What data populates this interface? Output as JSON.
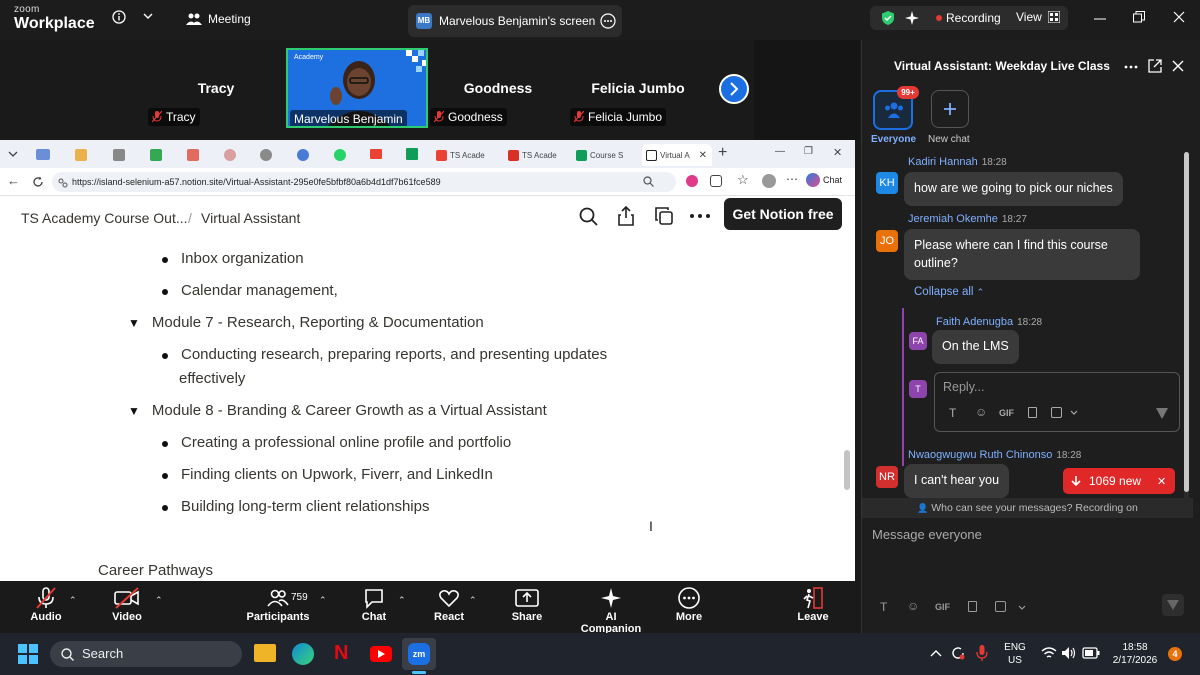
{
  "zoom": {
    "brand_top": "zoom",
    "brand_main": "Workplace",
    "meeting_label": "Meeting",
    "screen_badge": "MB",
    "screen_label": "Marvelous Benjamin's screen",
    "recording_label": "Recording",
    "view_label": "View"
  },
  "participants": [
    {
      "name": "Tracy",
      "tag": "Tracy"
    },
    {
      "name": "Marvelous Benjamin",
      "tag": "Marvelous Benjamin",
      "video_brand": "Academy"
    },
    {
      "name": "Goodness",
      "tag": "Goodness"
    },
    {
      "name": "Felicia Jumbo",
      "tag": "Felicia Jumbo"
    }
  ],
  "browser": {
    "tabs": [
      {
        "label": "TS Acade",
        "color": "#d93025"
      },
      {
        "label": "TS Acade",
        "color": "#d93025"
      },
      {
        "label": "Course S",
        "color": "#0f9d58"
      },
      {
        "label": "Virtual A",
        "color": "#222222",
        "active": true
      }
    ],
    "url": "https://island-selenium-a57.notion.site/Virtual-Assistant-295e0fe5bfbf80a6b4d1df7b61fce589",
    "chat_btn": "Chat"
  },
  "notion": {
    "crumb_parent": "TS Academy Course Out...",
    "crumb_sep": "/",
    "crumb_current": "Virtual Assistant",
    "get_notion": "Get Notion free",
    "lines": {
      "b1": "Inbox organization",
      "b2": "Calendar management,",
      "m7": "Module 7 - Research, Reporting & Documentation",
      "b3a": "Conducting research, preparing reports, and presenting updates",
      "b3b": "effectively",
      "m8": "Module 8 - Branding & Career Growth as a Virtual Assistant",
      "b4": "Creating a professional online profile and portfolio",
      "b5": "Finding clients on Upwork, Fiverr, and LinkedIn",
      "b6": "Building long-term client relationships",
      "section": "Career Pathways"
    }
  },
  "toolbar": {
    "audio": "Audio",
    "video": "Video",
    "participants": "Participants",
    "participants_count": "759",
    "chat": "Chat",
    "react": "React",
    "share": "Share",
    "ai": "AI Companion",
    "more": "More",
    "leave": "Leave"
  },
  "chat": {
    "title": "Virtual Assistant: Weekday Live Class",
    "everyone_label": "Everyone",
    "everyone_badge": "99+",
    "new_chat_label": "New chat",
    "messages": [
      {
        "initials": "KH",
        "sender": "Kadiri Hannah",
        "time": "18:28",
        "text": "how are we going to pick our niches",
        "color": "#1e88e5"
      },
      {
        "initials": "JO",
        "sender": "Jeremiah Okemhe",
        "time": "18:27",
        "text1": "Please where can I find this course",
        "text2": "outline?",
        "color": "#e8710a"
      },
      {
        "initials": "FA",
        "sender": "Faith Adenugba",
        "time": "18:28",
        "text": "On the LMS",
        "color": "#8e44ad"
      },
      {
        "initials": "NR",
        "sender": "Nwaogwugwu Ruth Chinonso",
        "time": "18:28",
        "text": "I can't hear you",
        "color": "#d32f2f"
      }
    ],
    "collapse_all": "Collapse all",
    "reply_avatar": "T",
    "reply_placeholder": "Reply...",
    "gif": "GIF",
    "new_count": "1069 new",
    "privacy": "Who can see your messages? Recording on",
    "compose_placeholder": "Message everyone"
  },
  "taskbar": {
    "search": "Search",
    "lang1": "ENG",
    "lang2": "US",
    "time": "18:58",
    "date": "2/17/2026",
    "notif": "4"
  },
  "colors": {
    "zoom_blue": "#1b6fe3",
    "record_red": "#e53935",
    "notion_text": "#37352f"
  }
}
